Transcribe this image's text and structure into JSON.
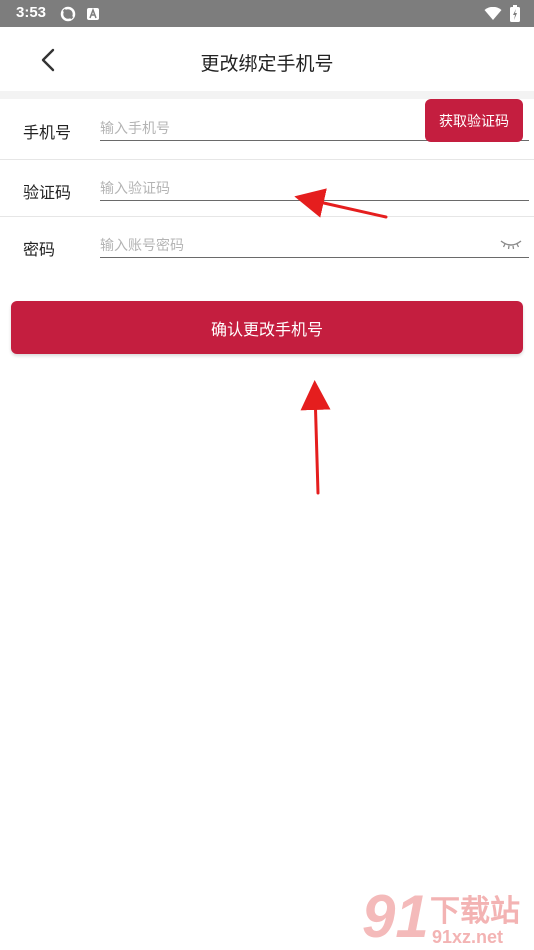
{
  "status_bar": {
    "time": "3:53",
    "icons": [
      "sync-icon",
      "keyboard-icon",
      "wifi-icon",
      "battery-icon"
    ]
  },
  "header": {
    "title": "更改绑定手机号",
    "back_icon": "chevron-left-icon"
  },
  "form": {
    "phone": {
      "label": "手机号",
      "placeholder": "输入手机号",
      "value": ""
    },
    "get_code_button": "获取验证码",
    "code": {
      "label": "验证码",
      "placeholder": "输入验证码",
      "value": ""
    },
    "password": {
      "label": "密码",
      "placeholder": "输入账号密码",
      "value": "",
      "toggle_icon": "eye-closed-icon"
    }
  },
  "confirm_button": "确认更改手机号",
  "watermark": {
    "logo_text": "91下载站",
    "url": "91xz.net"
  },
  "colors": {
    "accent": "#c41e3f",
    "status_bar": "#7d7d7d",
    "annotation": "#e51e1e"
  }
}
